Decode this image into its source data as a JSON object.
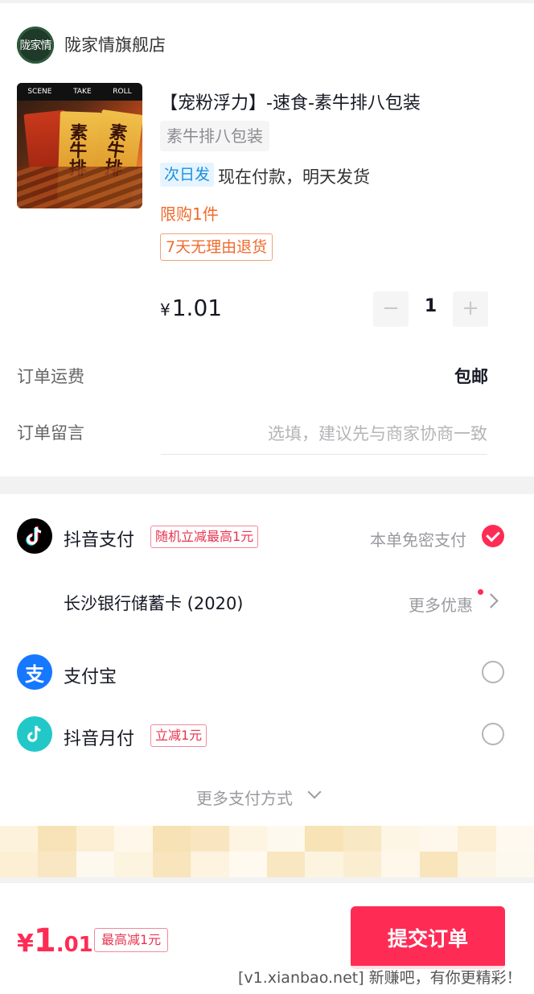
{
  "store": {
    "logo_text": "陇家情",
    "name": "陇家情旗舰店"
  },
  "product": {
    "thumb_banner": [
      "SCENE",
      "TAKE",
      "ROLL"
    ],
    "thumb_pack_text": "素牛排",
    "title": "【宠粉浮力】-速食-素牛排八包装",
    "sku": "素牛排八包装",
    "ship_badge": "次日发",
    "ship_text": "现在付款，明天发货",
    "limit": "限购1件",
    "return_policy": "7天无理由退货",
    "price_symbol": "¥",
    "price_value": "1.01",
    "quantity": "1",
    "minus": "−",
    "plus": "+"
  },
  "order": {
    "freight_label": "订单运费",
    "freight_value": "包邮",
    "message_label": "订单留言",
    "message_placeholder": "选填，建议先与商家协商一致"
  },
  "payment": {
    "douyin_pay": {
      "name": "抖音支付",
      "promo": "随机立减最高1元",
      "secure_text": "本单免密支付",
      "selected": true
    },
    "bank_card": {
      "name": "长沙银行储蓄卡 (2020)",
      "more": "更多优惠"
    },
    "alipay": {
      "name": "支付宝",
      "icon_glyph": "支",
      "selected": false
    },
    "douyin_monthly": {
      "name": "抖音月付",
      "promo": "立减1元",
      "selected": false
    },
    "more_methods": "更多支付方式"
  },
  "footer": {
    "total_symbol": "¥",
    "total_int": "1",
    "total_dec": ".01",
    "discount_tag": "最高减1元",
    "submit_label": "提交订单",
    "watermark": "[v1.xianbao.net] 新赚吧，有你更精彩！"
  },
  "colors": {
    "brand_red": "#fe2c55",
    "ship_blue": "#1a8fe0",
    "limit_orange": "#f06a2c",
    "alipay_blue": "#1677ff",
    "monthly_teal": "#22c8c8"
  }
}
